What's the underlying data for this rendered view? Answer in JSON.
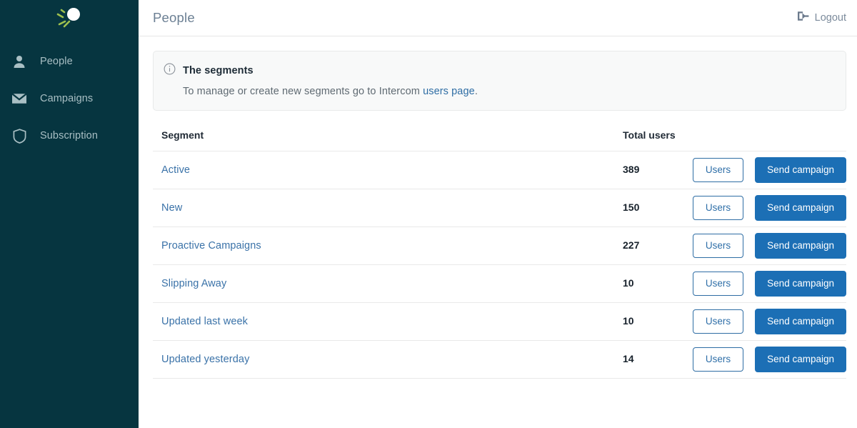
{
  "sidebar": {
    "logo_icon": "comet-logo-icon",
    "items": [
      {
        "label": "People",
        "icon": "person-icon"
      },
      {
        "label": "Campaigns",
        "icon": "envelope-icon"
      },
      {
        "label": "Subscription",
        "icon": "shield-icon"
      }
    ]
  },
  "header": {
    "title": "People",
    "logout_label": "Logout",
    "logout_icon": "sign-out-icon"
  },
  "alert": {
    "icon": "info-circle-icon",
    "title": "The segments",
    "body_before": "To manage or create new segments go to Intercom ",
    "link_text": "users page",
    "body_after": "."
  },
  "table": {
    "columns": {
      "segment": "Segment",
      "total_users": "Total users"
    },
    "buttons": {
      "users": "Users",
      "send_campaign": "Send campaign"
    },
    "rows": [
      {
        "segment": "Active",
        "total_users": "389"
      },
      {
        "segment": "New",
        "total_users": "150"
      },
      {
        "segment": "Proactive Campaigns",
        "total_users": "227"
      },
      {
        "segment": "Slipping Away",
        "total_users": "10"
      },
      {
        "segment": "Updated last week",
        "total_users": "10"
      },
      {
        "segment": "Updated yesterday",
        "total_users": "14"
      }
    ]
  },
  "colors": {
    "sidebar_bg": "#063540",
    "primary_blue": "#1c6fb5",
    "link_blue": "#3a72a8",
    "alert_bg": "#f8f9f9"
  }
}
